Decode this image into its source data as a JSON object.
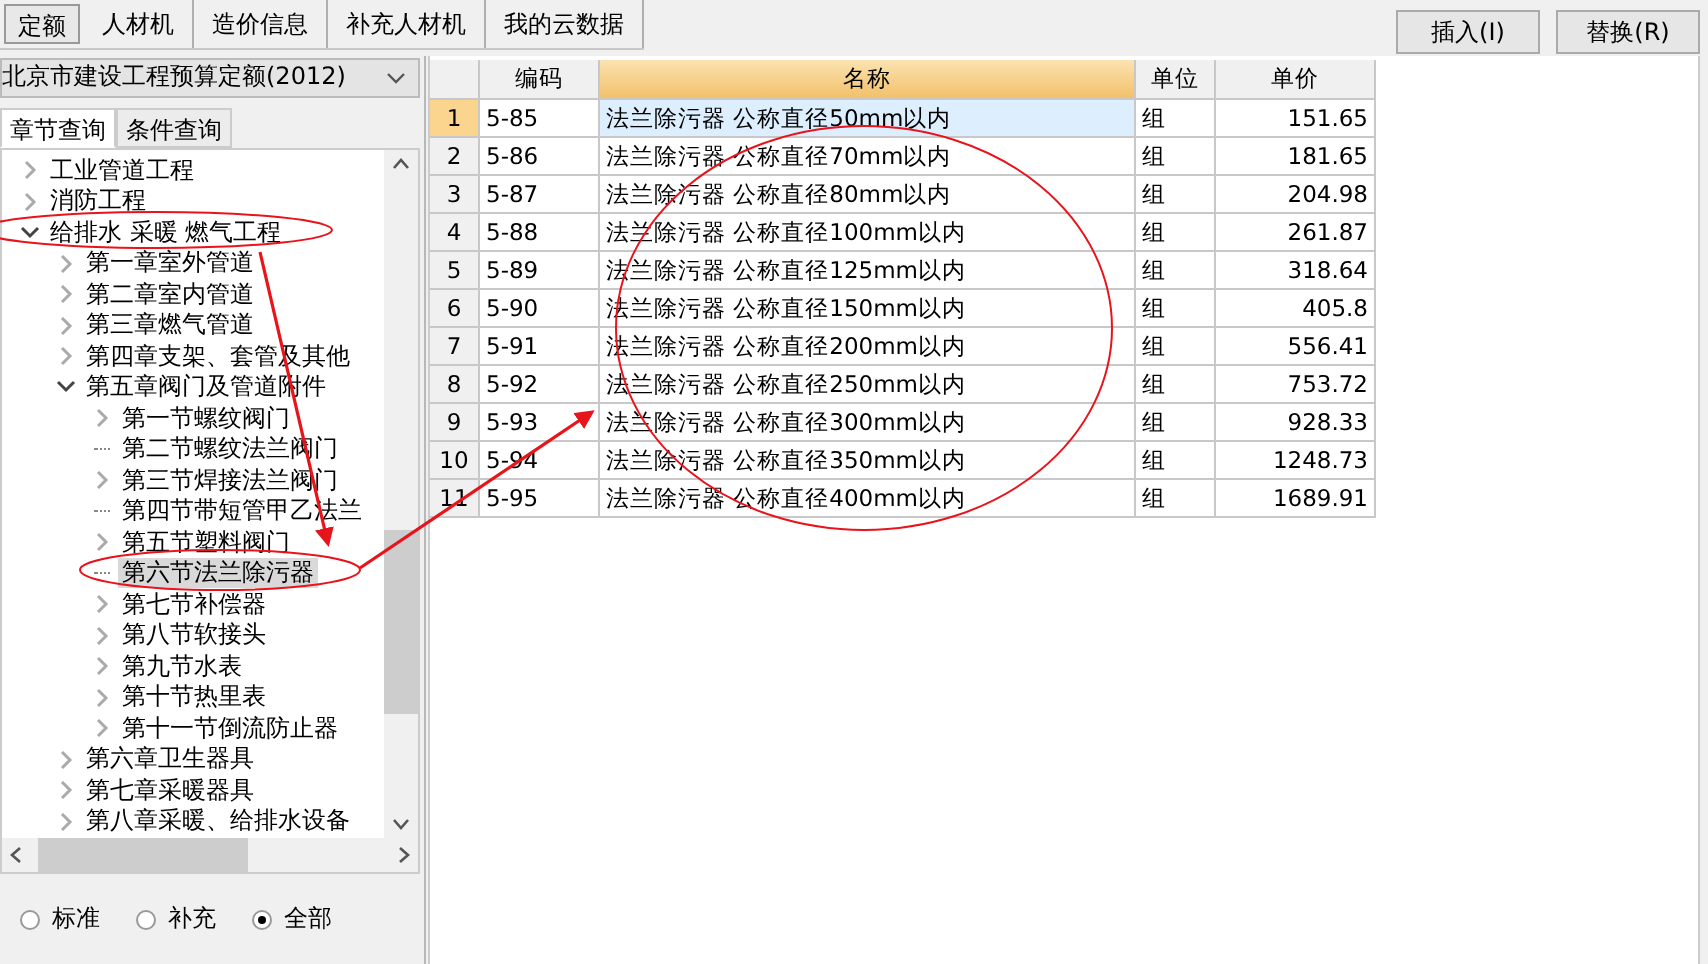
{
  "tabs": [
    {
      "label": "定额",
      "selected": true
    },
    {
      "label": "人材机",
      "selected": false
    },
    {
      "label": "造价信息",
      "selected": false
    },
    {
      "label": "补充人材机",
      "selected": false
    },
    {
      "label": "我的云数据",
      "selected": false
    }
  ],
  "actions": [
    "插入(I)",
    "替换(R)"
  ],
  "library": {
    "value": "北京市建设工程预算定额(2012)"
  },
  "query_tabs": [
    {
      "label": "章节查询",
      "selected": true
    },
    {
      "label": "条件查询",
      "selected": false
    }
  ],
  "tree": [
    {
      "label": "工业管道工程",
      "kind": "branch",
      "expanded": false,
      "selected": false
    },
    {
      "label": "消防工程",
      "kind": "branch",
      "expanded": false,
      "selected": false
    },
    {
      "label": "给排水 采暖 燃气工程",
      "kind": "branch",
      "expanded": true,
      "selected": false,
      "children": [
        {
          "label": "第一章室外管道",
          "kind": "branch",
          "expanded": false,
          "selected": false
        },
        {
          "label": "第二章室内管道",
          "kind": "branch",
          "expanded": false,
          "selected": false
        },
        {
          "label": "第三章燃气管道",
          "kind": "branch",
          "expanded": false,
          "selected": false
        },
        {
          "label": "第四章支架、套管及其他",
          "kind": "branch",
          "expanded": false,
          "selected": false
        },
        {
          "label": "第五章阀门及管道附件",
          "kind": "branch",
          "expanded": true,
          "selected": false,
          "children": [
            {
              "label": "第一节螺纹阀门",
              "kind": "branch",
              "expanded": false,
              "selected": false
            },
            {
              "label": "第二节螺纹法兰阀门",
              "kind": "leaf",
              "selected": false
            },
            {
              "label": "第三节焊接法兰阀门",
              "kind": "branch",
              "expanded": false,
              "selected": false
            },
            {
              "label": "第四节带短管甲乙法兰",
              "kind": "leaf",
              "selected": false
            },
            {
              "label": "第五节塑料阀门",
              "kind": "branch",
              "expanded": false,
              "selected": false
            },
            {
              "label": "第六节法兰除污器",
              "kind": "leaf",
              "selected": true
            },
            {
              "label": "第七节补偿器",
              "kind": "branch",
              "expanded": false,
              "selected": false
            },
            {
              "label": "第八节软接头",
              "kind": "branch",
              "expanded": false,
              "selected": false
            },
            {
              "label": "第九节水表",
              "kind": "branch",
              "expanded": false,
              "selected": false
            },
            {
              "label": "第十节热里表",
              "kind": "branch",
              "expanded": false,
              "selected": false
            },
            {
              "label": "第十一节倒流防止器",
              "kind": "branch",
              "expanded": false,
              "selected": false
            }
          ]
        },
        {
          "label": "第六章卫生器具",
          "kind": "branch",
          "expanded": false,
          "selected": false
        },
        {
          "label": "第七章采暖器具",
          "kind": "branch",
          "expanded": false,
          "selected": false
        },
        {
          "label": "第八章采暖、给排水设备",
          "kind": "branch",
          "expanded": false,
          "selected": false
        }
      ]
    }
  ],
  "filter": [
    {
      "label": "标准",
      "selected": false
    },
    {
      "label": "补充",
      "selected": false
    },
    {
      "label": "全部",
      "selected": true
    }
  ],
  "table": {
    "columns": [
      {
        "label": "编码",
        "highlighted": false
      },
      {
        "label": "名称",
        "highlighted": true
      },
      {
        "label": "单位",
        "highlighted": false
      },
      {
        "label": "单价",
        "highlighted": false
      }
    ],
    "rows": [
      {
        "number": "1",
        "code": "5-85",
        "name": "法兰除污器 公称直径50mm以内",
        "unit": "组",
        "price": "151.65",
        "selected": true
      },
      {
        "number": "2",
        "code": "5-86",
        "name": "法兰除污器 公称直径70mm以内",
        "unit": "组",
        "price": "181.65",
        "selected": false
      },
      {
        "number": "3",
        "code": "5-87",
        "name": "法兰除污器 公称直径80mm以内",
        "unit": "组",
        "price": "204.98",
        "selected": false
      },
      {
        "number": "4",
        "code": "5-88",
        "name": "法兰除污器 公称直径100mm以内",
        "unit": "组",
        "price": "261.87",
        "selected": false
      },
      {
        "number": "5",
        "code": "5-89",
        "name": "法兰除污器 公称直径125mm以内",
        "unit": "组",
        "price": "318.64",
        "selected": false
      },
      {
        "number": "6",
        "code": "5-90",
        "name": "法兰除污器 公称直径150mm以内",
        "unit": "组",
        "price": "405.8",
        "selected": false
      },
      {
        "number": "7",
        "code": "5-91",
        "name": "法兰除污器 公称直径200mm以内",
        "unit": "组",
        "price": "556.41",
        "selected": false
      },
      {
        "number": "8",
        "code": "5-92",
        "name": "法兰除污器 公称直径250mm以内",
        "unit": "组",
        "price": "753.72",
        "selected": false
      },
      {
        "number": "9",
        "code": "5-93",
        "name": "法兰除污器 公称直径300mm以内",
        "unit": "组",
        "price": "928.33",
        "selected": false
      },
      {
        "number": "10",
        "code": "5-94",
        "name": "法兰除污器 公称直径350mm以内",
        "unit": "组",
        "price": "1248.73",
        "selected": false
      },
      {
        "number": "11",
        "code": "5-95",
        "name": "法兰除污器 公称直径400mm以内",
        "unit": "组",
        "price": "1689.91",
        "selected": false
      }
    ]
  }
}
